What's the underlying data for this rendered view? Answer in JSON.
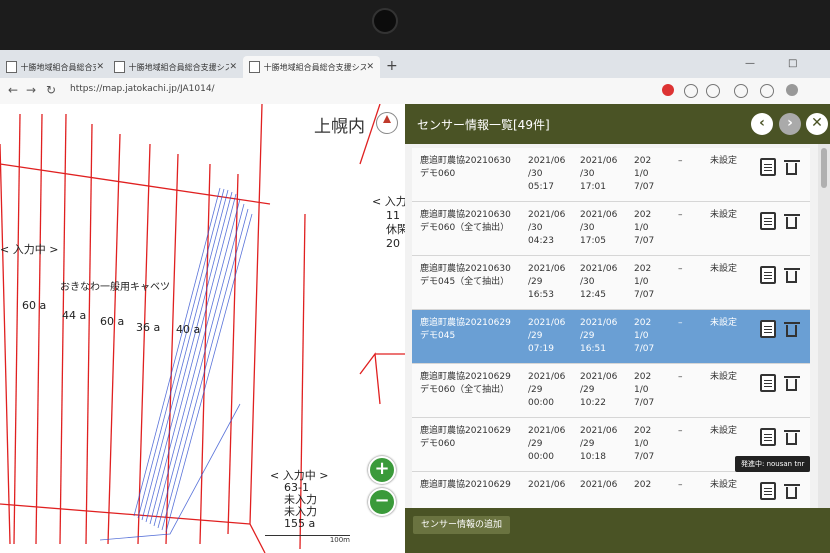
{
  "browser": {
    "tabs": [
      {
        "label": "十勝地域組合員総合支援システム",
        "active": false
      },
      {
        "label": "十勝地域組合員総合支援システム",
        "active": false
      },
      {
        "label": "十勝地域組合員総合支援システム",
        "active": true
      }
    ],
    "new_tab": "+",
    "url": "https://map.jatokachi.jp/JA1014/",
    "window_controls": {
      "minimize": "—",
      "maximize": "□",
      "close": "✕"
    }
  },
  "map": {
    "place_name": "上幌内",
    "labels": [
      {
        "text": "< 入力中 >"
      },
      {
        "text": "おきなわ一般用キャベツ"
      },
      {
        "text": "60 a"
      },
      {
        "text": "44 a"
      },
      {
        "text": "60 a"
      },
      {
        "text": "36 a"
      },
      {
        "text": "40 a"
      },
      {
        "text": "< 入力中 >"
      },
      {
        "text": "11"
      },
      {
        "text": "休閑"
      },
      {
        "text": "20"
      }
    ],
    "bottom_label": {
      "line1": "< 入力中 >",
      "line2": "63-1",
      "line3": "未入力",
      "line4": "未入力",
      "line5": "155 a"
    },
    "scale_label": "100m",
    "zoom_in": "+",
    "zoom_out": "−"
  },
  "panel": {
    "title": "センサー情報一覧[49件]",
    "nav_prev": "‹",
    "nav_next": "›",
    "close": "✕",
    "rows": [
      {
        "name": "鹿追町農協20210630\nデモ060",
        "date1": "2021/06\n/30\n05:17",
        "date2": "2021/06\n/30\n17:01",
        "date3": "202\n1/0\n7/07",
        "dash": "–",
        "status": "未設定",
        "selected": false
      },
      {
        "name": "鹿追町農協20210630\nデモ060（全て抽出）",
        "date1": "2021/06\n/30\n04:23",
        "date2": "2021/06\n/30\n17:05",
        "date3": "202\n1/0\n7/07",
        "dash": "–",
        "status": "未設定",
        "selected": false
      },
      {
        "name": "鹿追町農協20210630\nデモ045（全て抽出）",
        "date1": "2021/06\n/29\n16:53",
        "date2": "2021/06\n/30\n12:45",
        "date3": "202\n1/0\n7/07",
        "dash": "–",
        "status": "未設定",
        "selected": false
      },
      {
        "name": "鹿追町農協20210629\nデモ045",
        "date1": "2021/06\n/29\n07:19",
        "date2": "2021/06\n/29\n16:51",
        "date3": "202\n1/0\n7/07",
        "dash": "–",
        "status": "未設定",
        "selected": true
      },
      {
        "name": "鹿追町農協20210629\nデモ060（全て抽出）",
        "date1": "2021/06\n/29\n00:00",
        "date2": "2021/06\n/29\n10:22",
        "date3": "202\n1/0\n7/07",
        "dash": "–",
        "status": "未設定",
        "selected": false
      },
      {
        "name": "鹿追町農協20210629\nデモ060",
        "date1": "2021/06\n/29\n00:00",
        "date2": "2021/06\n/29\n10:18",
        "date3": "202\n1/0\n7/07",
        "dash": "–",
        "status": "未設定",
        "selected": false
      },
      {
        "name": "鹿追町農協20210629",
        "date1": "2021/06",
        "date2": "2021/06",
        "date3": "202",
        "dash": "–",
        "status": "未設定",
        "selected": false
      }
    ],
    "tooltip": "発進中: nousan tnr",
    "add_button": "センサー情報の追加"
  },
  "colors": {
    "panel_header": "#4a5325",
    "selected_row": "#6a9fd4",
    "parcel_line": "#e02020",
    "track_line": "#3050d0",
    "zoom_button": "#3a9a3a"
  }
}
